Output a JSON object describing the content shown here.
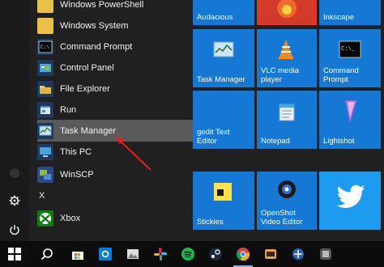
{
  "app_list": {
    "items": [
      {
        "label": "Windows PowerShell"
      },
      {
        "label": "Windows System"
      },
      {
        "label": "Command Prompt"
      },
      {
        "label": "Control Panel"
      },
      {
        "label": "File Explorer"
      },
      {
        "label": "Run"
      },
      {
        "label": "Task Manager"
      },
      {
        "label": "This PC"
      },
      {
        "label": "WinSCP"
      },
      {
        "label": "Xbox"
      }
    ],
    "section_x": "X"
  },
  "tiles": {
    "audacious": "Audacious",
    "inkscape": "Inkscape",
    "task_manager": "Task Manager",
    "vlc": "VLC media player",
    "cmd": "Command Prompt",
    "gedit": "gedit Text Editor",
    "notepad": "Notepad",
    "lightshot": "Lightshot",
    "stickies": "Stickies",
    "openshot": "OpenShot Video Editor"
  },
  "colors": {
    "tile_blue": "#1578d4",
    "highlight": "#5a5a5a",
    "annotation_arrow": "#e02020",
    "twitter_bg": "#1d9bf0"
  },
  "icons": {
    "rail": [
      "settings-icon",
      "power-icon",
      "windows-logo-icon"
    ],
    "taskbar": [
      "windows-logo-icon",
      "search-icon",
      "store-icon",
      "outlook-icon",
      "photo-icon",
      "slack-icon",
      "spotify-icon",
      "steam-icon",
      "chrome-icon",
      "app-icon-9",
      "app-icon-10",
      "app-icon-11"
    ]
  }
}
